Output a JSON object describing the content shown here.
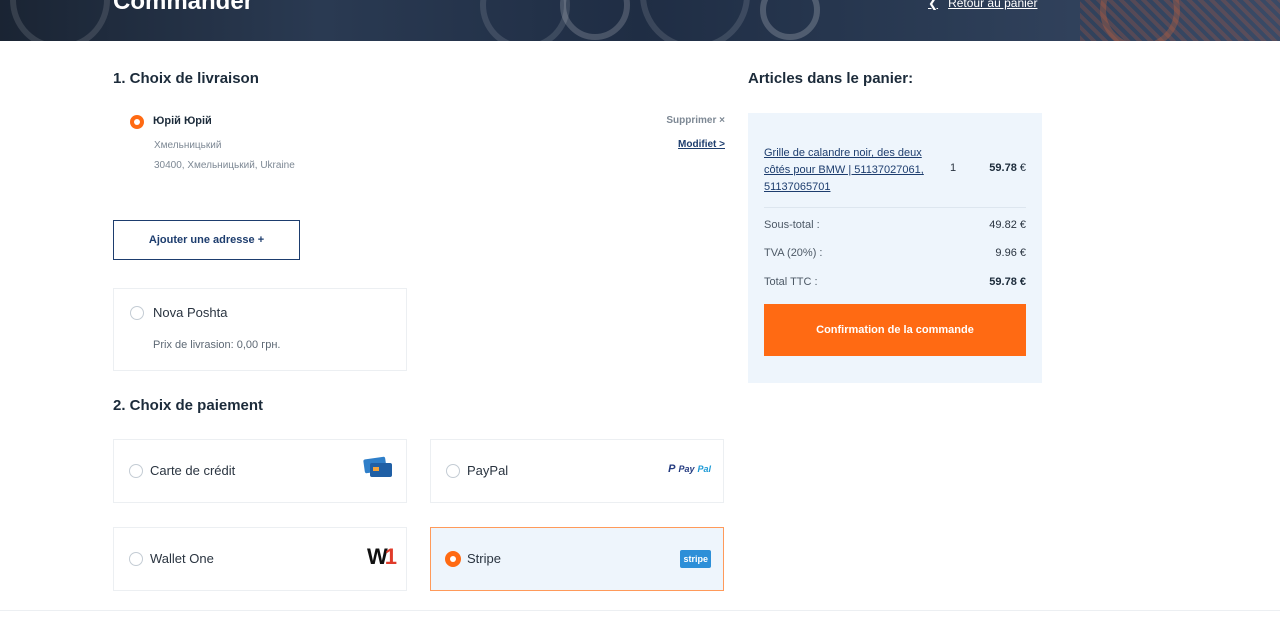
{
  "header": {
    "title": "Commander",
    "back_link": "Retour au panier"
  },
  "delivery": {
    "section_title": "1. Choix de livraison",
    "address": {
      "name": "Юрій Юрій",
      "city": "Хмельницький",
      "zip_line": "30400, Хмельницький, Ukraine",
      "delete_label": "Supprimer ×",
      "edit_label": "Modifiet >"
    },
    "add_address_label": "Ajouter une adresse +",
    "shipping_option": {
      "name": "Nova Poshta",
      "price_label": "Prix de livrasion: 0,00 грн."
    }
  },
  "payment": {
    "section_title": "2. Choix de paiement",
    "options": [
      {
        "label": "Carte de crédit",
        "logo": "credit-card-icon",
        "selected": false
      },
      {
        "label": "PayPal",
        "logo": "paypal-logo",
        "logo_text_a": "Pay",
        "logo_text_b": "Pal",
        "selected": false
      },
      {
        "label": "Wallet One",
        "logo": "wallet-one-logo",
        "logo_text_a": "W",
        "logo_text_b": "1",
        "selected": false
      },
      {
        "label": "Stripe",
        "logo": "stripe-logo",
        "logo_text": "stripe",
        "selected": true
      }
    ]
  },
  "cart": {
    "title": "Articles dans le panier:",
    "item": {
      "name": "Grille de calandre noir, des deux côtés pour BMW | 51137027061, 51137065701",
      "quantity": "1",
      "price": "59.78",
      "currency": "€"
    },
    "subtotal_label": "Sous-total :",
    "subtotal_value": "49.82 €",
    "vat_label": "TVA (20%) :",
    "vat_value": "9.96 €",
    "total_label": "Total TTC :",
    "total_value": "59.78 €",
    "confirm_label": "Confirmation de la commande"
  },
  "colors": {
    "accent": "#ff6a13",
    "navy": "#1d3d6e",
    "cart_bg": "#eef5fc"
  }
}
